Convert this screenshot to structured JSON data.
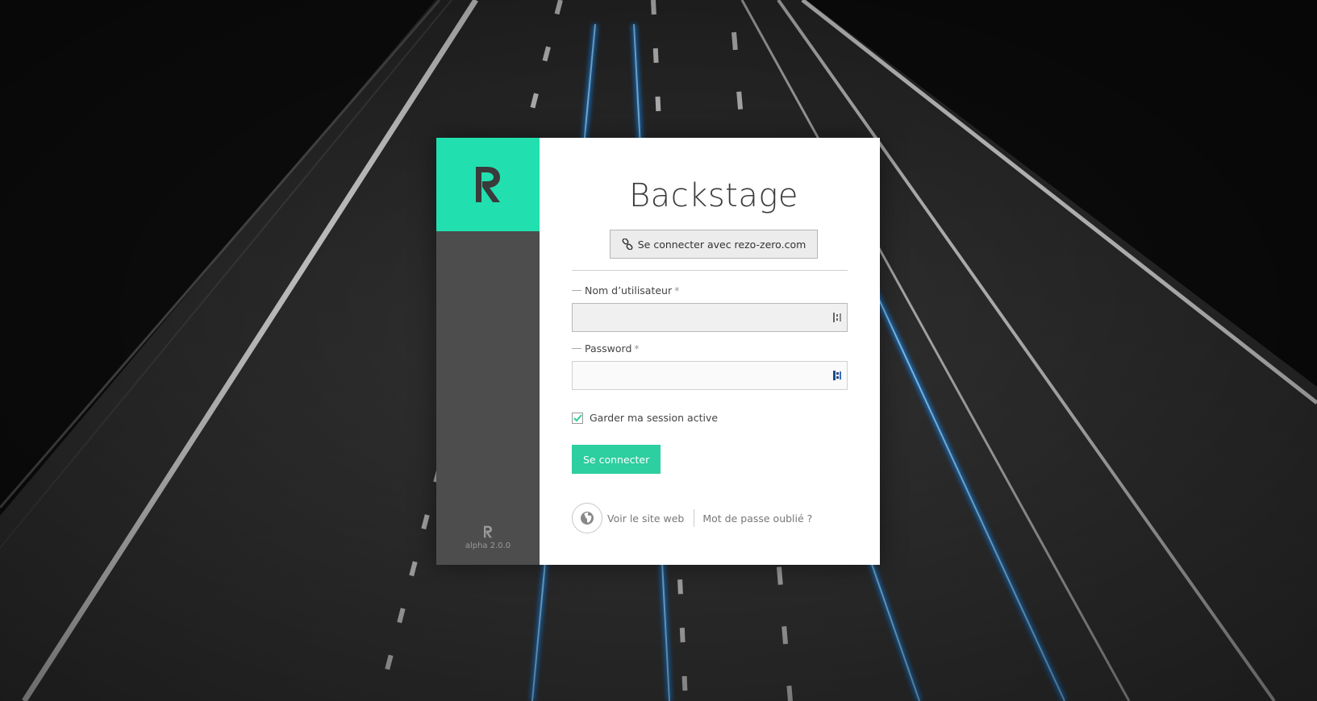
{
  "brand": {
    "accent_color": "#22dfb0",
    "logo_icon": "rz-logo-icon",
    "version": "alpha 2.0.0"
  },
  "login": {
    "title": "Backstage",
    "sso_button_label": "Se connecter avec rezo-zero.com",
    "sso_icon": "link-icon",
    "username": {
      "label": "Nom d’utilisateur",
      "required_mark": "*",
      "value": ""
    },
    "password": {
      "label": "Password",
      "required_mark": "*",
      "value": ""
    },
    "remember": {
      "label": "Garder ma session active",
      "checked": true
    },
    "submit_label": "Se connecter",
    "submit_color": "#2dce9f"
  },
  "footer_links": {
    "website_label": "Voir le site web",
    "website_icon": "globe-icon",
    "forgot_label": "Mot de passe oublié ?"
  }
}
